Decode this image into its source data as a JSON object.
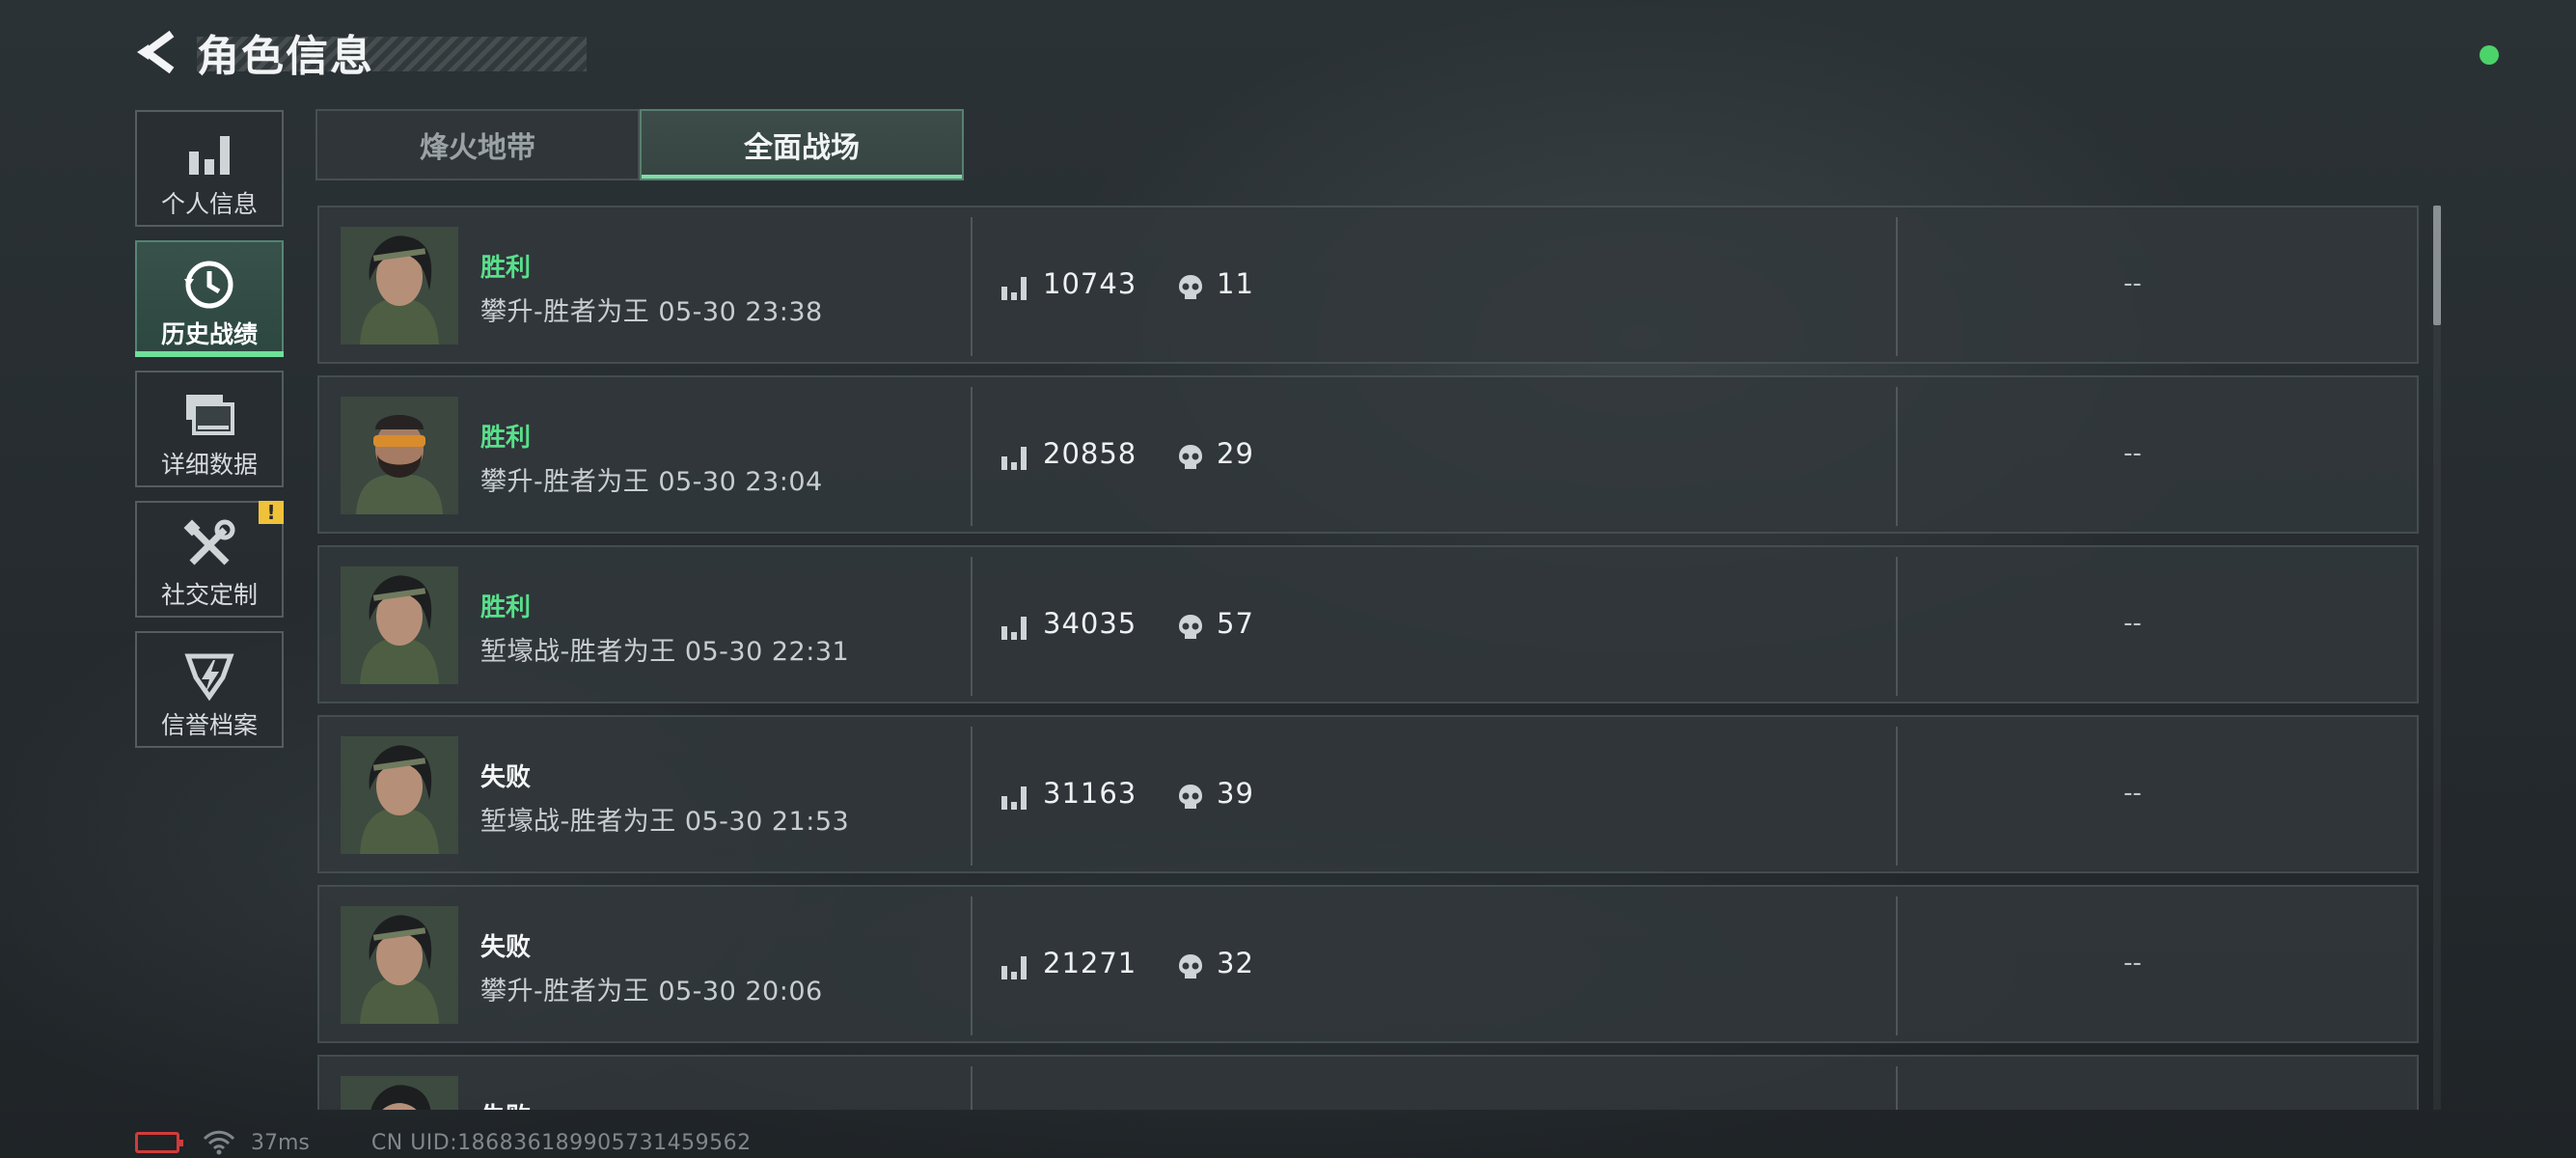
{
  "header": {
    "title": "角色信息"
  },
  "sidebar": {
    "items": [
      {
        "label": "个人信息",
        "icon": "bar-chart-icon",
        "active": false
      },
      {
        "label": "历史战绩",
        "icon": "history-clock-icon",
        "active": true
      },
      {
        "label": "详细数据",
        "icon": "folders-icon",
        "active": false
      },
      {
        "label": "社交定制",
        "icon": "tools-icon",
        "active": false,
        "badge": "!"
      },
      {
        "label": "信誉档案",
        "icon": "reputation-shield-icon",
        "active": false
      }
    ]
  },
  "tabs": [
    {
      "label": "烽火地带",
      "active": false
    },
    {
      "label": "全面战场",
      "active": true
    }
  ],
  "records": [
    {
      "result": "胜利",
      "outcome": "win",
      "mode": "攀升-胜者为王 05-30 23:38",
      "score": "10743",
      "kills": "11",
      "extra": "--",
      "avatar": "female-operator"
    },
    {
      "result": "胜利",
      "outcome": "win",
      "mode": "攀升-胜者为王 05-30 23:04",
      "score": "20858",
      "kills": "29",
      "extra": "--",
      "avatar": "bearded-operator"
    },
    {
      "result": "胜利",
      "outcome": "win",
      "mode": "堑壕战-胜者为王 05-30 22:31",
      "score": "34035",
      "kills": "57",
      "extra": "--",
      "avatar": "female-operator"
    },
    {
      "result": "失败",
      "outcome": "lose",
      "mode": "堑壕战-胜者为王 05-30 21:53",
      "score": "31163",
      "kills": "39",
      "extra": "--",
      "avatar": "female-operator"
    },
    {
      "result": "失败",
      "outcome": "lose",
      "mode": "攀升-胜者为王 05-30 20:06",
      "score": "21271",
      "kills": "32",
      "extra": "--",
      "avatar": "female-operator"
    },
    {
      "result": "失败",
      "outcome": "lose",
      "mode": "",
      "score": "",
      "kills": "",
      "extra": "",
      "avatar": "female-operator"
    }
  ],
  "footer": {
    "ping": "37ms",
    "uid": "CN UID:186836189905731459562"
  },
  "colors": {
    "win": "#58e08a",
    "accent": "#6fe09a",
    "status_online": "#4cd36a",
    "badge": "#f0c23a",
    "battery_low": "#d23b3b"
  }
}
